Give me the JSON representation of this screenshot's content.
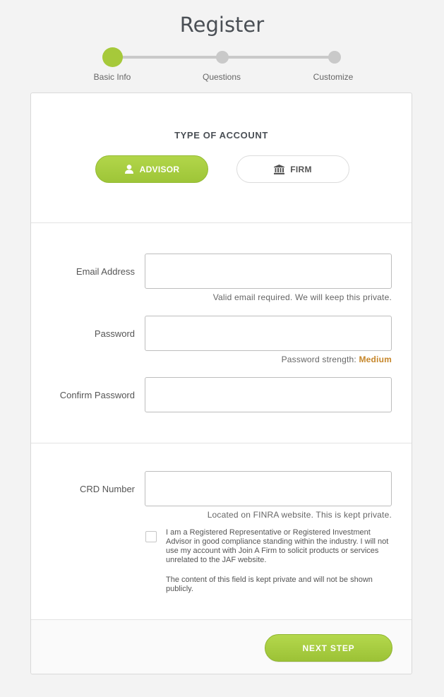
{
  "page": {
    "title": "Register"
  },
  "progress": {
    "steps": [
      {
        "label": "Basic Info",
        "state": "active"
      },
      {
        "label": "Questions",
        "state": "pending"
      },
      {
        "label": "Customize",
        "state": "pending"
      }
    ],
    "accent_color": "#a6c93a",
    "inactive_color": "#c9c9c9"
  },
  "account_type": {
    "heading": "TYPE OF ACCOUNT",
    "options": [
      {
        "label": "ADVISOR",
        "icon": "user-icon",
        "selected": true
      },
      {
        "label": "FIRM",
        "icon": "bank-icon",
        "selected": false
      }
    ]
  },
  "form": {
    "email": {
      "label": "Email Address",
      "value": "",
      "placeholder": "",
      "hint": "Valid email required. We will keep this private."
    },
    "password": {
      "label": "Password",
      "value": "",
      "placeholder": "",
      "hint_prefix": "Password strength: ",
      "strength": "Medium",
      "strength_color": "#c6862a"
    },
    "confirm_password": {
      "label": "Confirm Password",
      "value": "",
      "placeholder": ""
    },
    "crd": {
      "label": "CRD Number",
      "value": "",
      "placeholder": "",
      "hint": "Located on FINRA website. This is kept private."
    },
    "agreement": {
      "checked": false,
      "text": " I am a Registered Representative or Registered Investment Advisor in good compliance standing within the industry. I will not use my account with Join A Firm to solicit products or services unrelated to the JAF website.",
      "note": "The content of this field is kept private and will not be shown publicly."
    }
  },
  "footer": {
    "next_label": "NEXT STEP"
  }
}
